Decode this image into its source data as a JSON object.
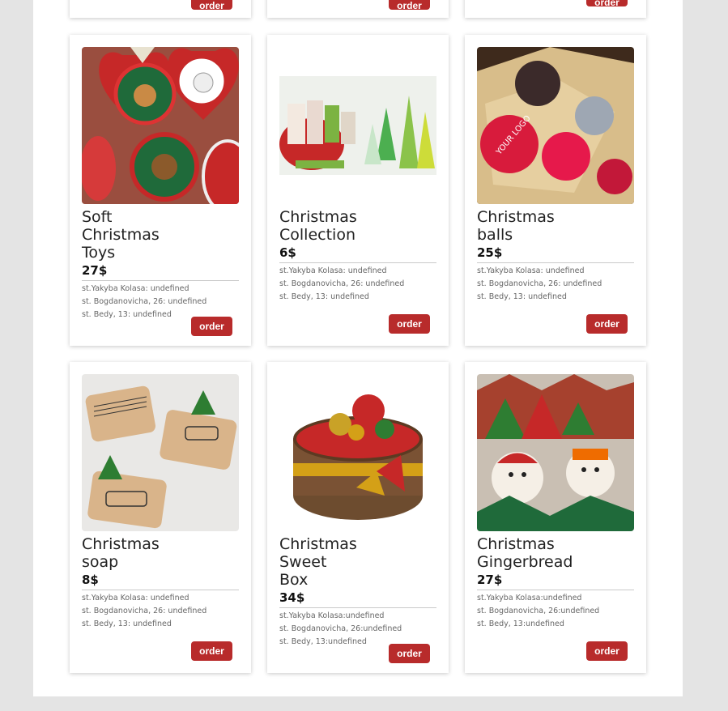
{
  "colors": {
    "page_background": "#e4e4e4",
    "panel_background": "#ffffff",
    "button_red": "#b82b2b"
  },
  "order_label": "order",
  "top_row_partial": [
    {
      "button_label": "order"
    },
    {
      "button_label": "order"
    },
    {
      "button_label": "order"
    }
  ],
  "products": [
    {
      "title_lines": [
        "Soft",
        "Christmas",
        "Toys"
      ],
      "price": "27$",
      "addresses": [
        "st.Yakyba Kolasa: undefined",
        "st. Bogdanovicha, 26: undefined",
        "st. Bedy, 13: undefined"
      ],
      "button_label": "order",
      "image": "felt-dog-ornaments-image"
    },
    {
      "title_lines": [
        "Christmas",
        "Collection"
      ],
      "price": "6$",
      "addresses": [
        "st.Yakyba Kolasa: undefined",
        "st. Bogdanovicha, 26: undefined",
        "st. Bedy, 13: undefined"
      ],
      "button_label": "order",
      "image": "gift-set-trees-image"
    },
    {
      "title_lines": [
        "Christmas",
        "balls"
      ],
      "price": "25$",
      "addresses": [
        "st.Yakyba Kolasa: undefined",
        "st. Bogdanovicha, 26: undefined",
        "st. Bedy, 13: undefined"
      ],
      "button_label": "order",
      "image": "christmas-balls-image"
    },
    {
      "title_lines": [
        "Christmas",
        "soap"
      ],
      "price": "8$",
      "addresses": [
        "st.Yakyba Kolasa: undefined",
        "st. Bogdanovicha, 26: undefined",
        "st. Bedy, 13: undefined"
      ],
      "button_label": "order",
      "image": "wrapped-soap-image"
    },
    {
      "title_lines": [
        "Christmas",
        "Sweet",
        "Box"
      ],
      "price": "34$",
      "addresses": [
        "st.Yakyba Kolasa:undefined",
        "st. Bogdanovicha, 26:undefined",
        "st. Bedy, 13:undefined"
      ],
      "button_label": "order",
      "image": "sweet-box-image"
    },
    {
      "title_lines": [
        "Christmas",
        "Gingerbread"
      ],
      "price": "27$",
      "addresses": [
        "st.Yakyba Kolasa:undefined",
        "st. Bogdanovicha, 26:undefined",
        "st. Bedy, 13:undefined"
      ],
      "button_label": "order",
      "image": "gingerbread-cookies-image"
    }
  ]
}
